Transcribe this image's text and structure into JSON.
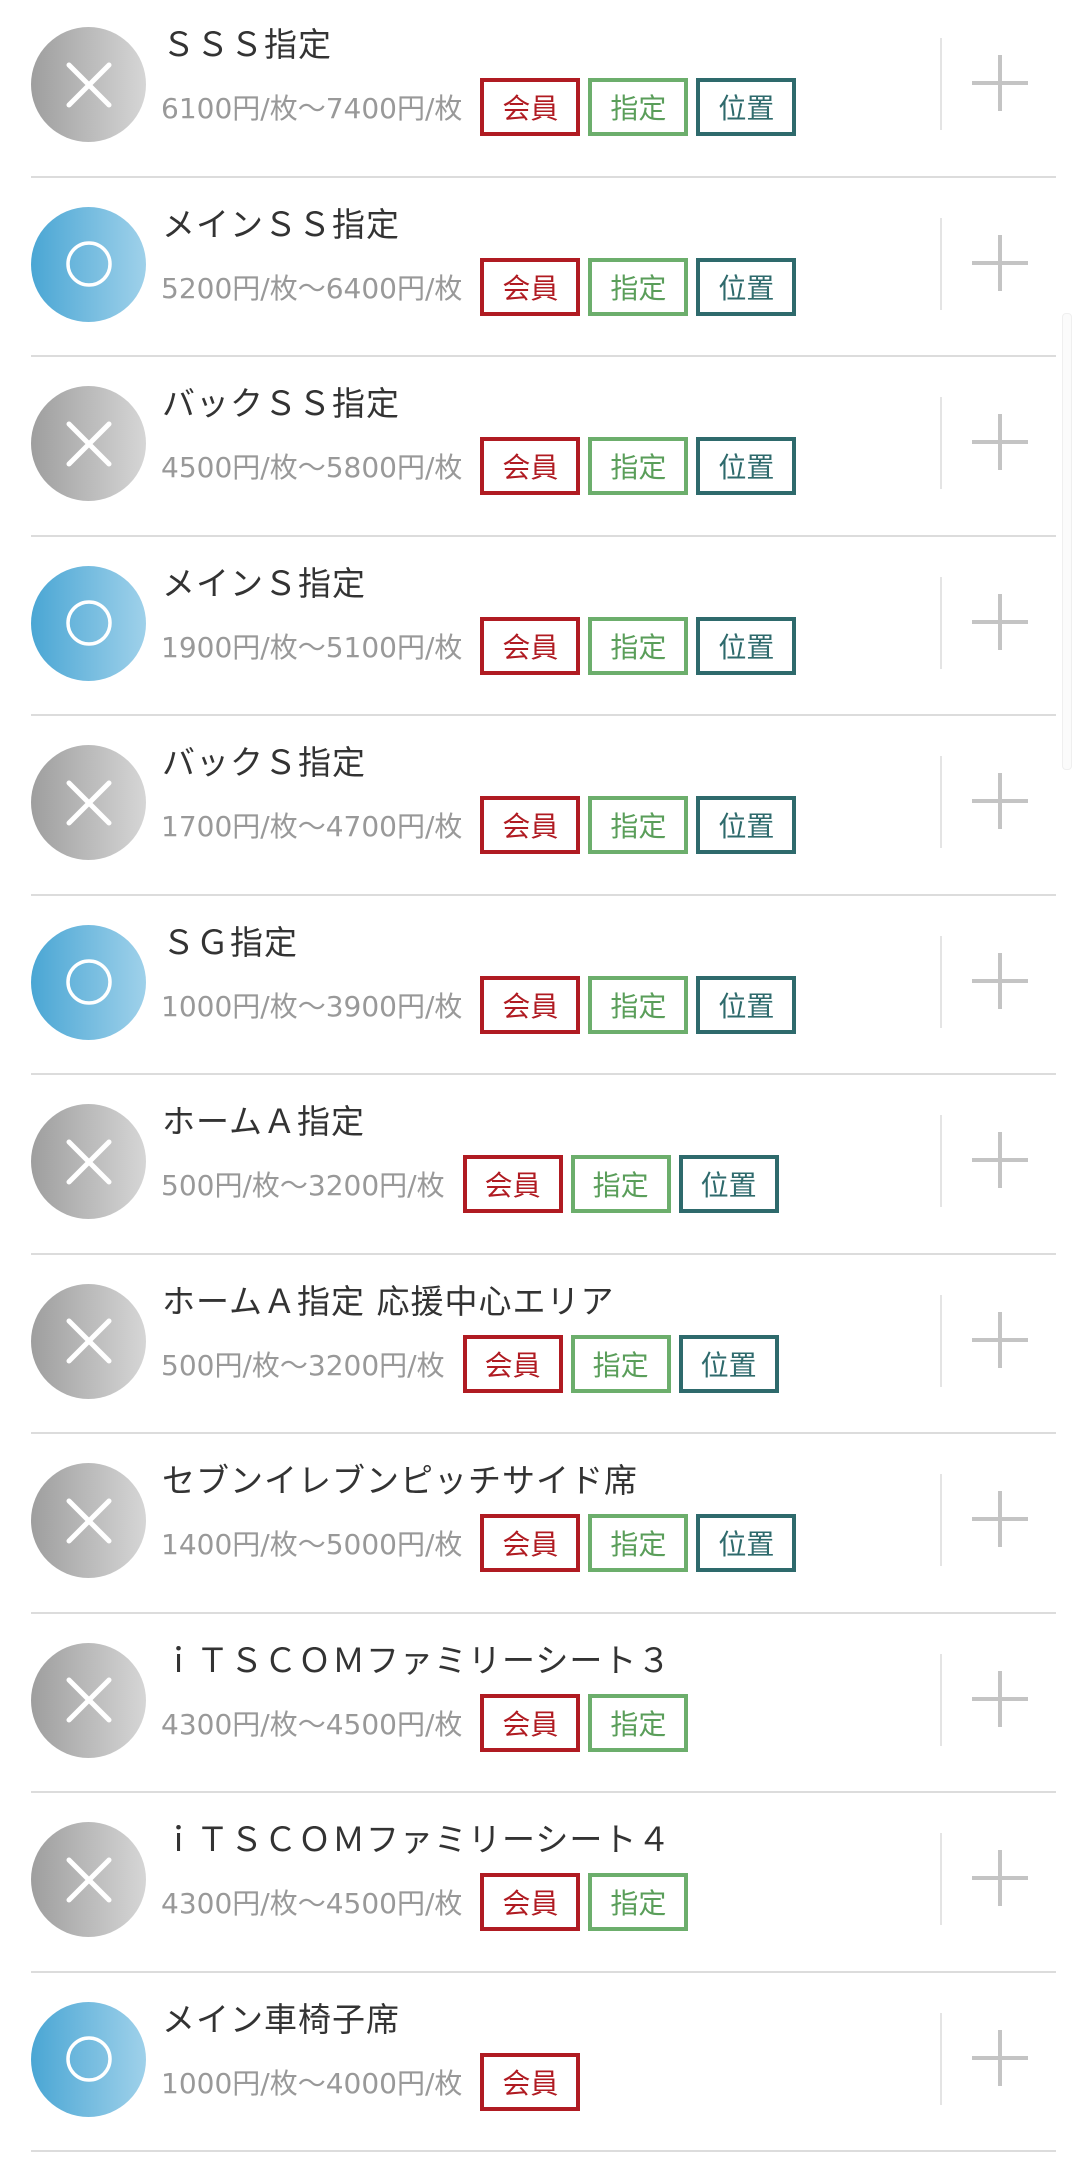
{
  "tag_labels": {
    "member": "会員",
    "designated": "指定",
    "position": "位置"
  },
  "colors": {
    "unavailable_badge": "#9e9e9e",
    "available_badge": "#4aa6d4",
    "member_tag": "#b01b22",
    "designated_tag": "#6cae6c",
    "position_tag": "#2e6a6c",
    "price_text": "#999999",
    "name_text": "#333333"
  },
  "seats": [
    {
      "name": "ＳＳＳ指定",
      "price": "6100円/枚〜7400円/枚",
      "available": false,
      "status_icon": "x-icon",
      "tags": [
        "member",
        "designated",
        "position"
      ]
    },
    {
      "name": "メインＳＳ指定",
      "price": "5200円/枚〜6400円/枚",
      "available": true,
      "status_icon": "circle-icon",
      "tags": [
        "member",
        "designated",
        "position"
      ]
    },
    {
      "name": "バックＳＳ指定",
      "price": "4500円/枚〜5800円/枚",
      "available": false,
      "status_icon": "x-icon",
      "tags": [
        "member",
        "designated",
        "position"
      ]
    },
    {
      "name": "メインＳ指定",
      "price": "1900円/枚〜5100円/枚",
      "available": true,
      "status_icon": "circle-icon",
      "tags": [
        "member",
        "designated",
        "position"
      ]
    },
    {
      "name": "バックＳ指定",
      "price": "1700円/枚〜4700円/枚",
      "available": false,
      "status_icon": "x-icon",
      "tags": [
        "member",
        "designated",
        "position"
      ]
    },
    {
      "name": "ＳＧ指定",
      "price": "1000円/枚〜3900円/枚",
      "available": true,
      "status_icon": "circle-icon",
      "tags": [
        "member",
        "designated",
        "position"
      ]
    },
    {
      "name": "ホームＡ指定",
      "price": "500円/枚〜3200円/枚",
      "available": false,
      "status_icon": "x-icon",
      "tags": [
        "member",
        "designated",
        "position"
      ]
    },
    {
      "name": "ホームＡ指定 応援中心エリア",
      "price": "500円/枚〜3200円/枚",
      "available": false,
      "status_icon": "x-icon",
      "tags": [
        "member",
        "designated",
        "position"
      ]
    },
    {
      "name": "セブンイレブンピッチサイド席",
      "price": "1400円/枚〜5000円/枚",
      "available": false,
      "status_icon": "x-icon",
      "tags": [
        "member",
        "designated",
        "position"
      ]
    },
    {
      "name": "ｉＴＳＣＯＭファミリーシート３",
      "price": "4300円/枚〜4500円/枚",
      "available": false,
      "status_icon": "x-icon",
      "tags": [
        "member",
        "designated"
      ]
    },
    {
      "name": "ｉＴＳＣＯＭファミリーシート４",
      "price": "4300円/枚〜4500円/枚",
      "available": false,
      "status_icon": "x-icon",
      "tags": [
        "member",
        "designated"
      ]
    },
    {
      "name": "メイン車椅子席",
      "price": "1000円/枚〜4000円/枚",
      "available": true,
      "status_icon": "circle-icon",
      "tags": [
        "member"
      ]
    }
  ]
}
